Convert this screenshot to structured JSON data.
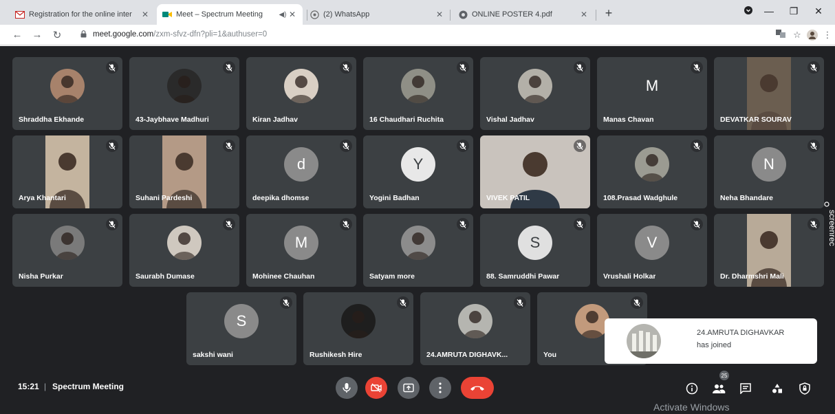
{
  "browser": {
    "tabs": [
      {
        "title": "Registration for the online inter",
        "active": false,
        "favicon": "gmail-icon"
      },
      {
        "title": "Meet – Spectrum Meeting",
        "active": true,
        "favicon": "meet-icon"
      },
      {
        "title": "(2) WhatsApp",
        "active": false,
        "favicon": "whatsapp-icon"
      },
      {
        "title": "ONLINE POSTER 4.pdf",
        "active": false,
        "favicon": "pdf-icon"
      }
    ],
    "url_host": "meet.google.com",
    "url_path": "/zxm-sfvz-dfn?pli=1&authuser=0"
  },
  "participants": [
    {
      "name": "Shraddha Ekhande",
      "type": "photo",
      "tone": "#a7826b"
    },
    {
      "name": "43-Jaybhave Madhuri",
      "type": "photo",
      "tone": "#2a2a2a"
    },
    {
      "name": "Kiran Jadhav",
      "type": "photo",
      "tone": "#d9cfc4"
    },
    {
      "name": "16 Chaudhari Ruchita",
      "type": "photo",
      "tone": "#8f8f86"
    },
    {
      "name": "Vishal Jadhav",
      "type": "photo",
      "tone": "#b3b0a8"
    },
    {
      "name": "Manas Chavan",
      "type": "letter",
      "letter": "M",
      "color": "#3c4043"
    },
    {
      "name": "DEVATKAR SOURAV",
      "type": "video",
      "tone": "#6b5e50"
    },
    {
      "name": "Arya Khantari",
      "type": "video",
      "tone": "#c4b49f"
    },
    {
      "name": "Suhani Pardeshi",
      "type": "video",
      "tone": "#b49a86"
    },
    {
      "name": "deepika dhomse",
      "type": "letter",
      "letter": "d",
      "color": "#8a8a8a"
    },
    {
      "name": "Yogini Badhan",
      "type": "letter",
      "letter": "Y",
      "color": "#e8e8e8"
    },
    {
      "name": "VIVEK PATIL",
      "type": "fullvideo",
      "tone": "#c9c3bd"
    },
    {
      "name": "108.Prasad Wadghule",
      "type": "photo",
      "tone": "#9b9b92"
    },
    {
      "name": "Neha Bhandare",
      "type": "letter",
      "letter": "N",
      "color": "#8a8a8a"
    },
    {
      "name": "Nisha Purkar",
      "type": "photo",
      "tone": "#7a7a7a"
    },
    {
      "name": "Saurabh Dumase",
      "type": "photo",
      "tone": "#cfc8bf"
    },
    {
      "name": "Mohinee Chauhan",
      "type": "letter",
      "letter": "M",
      "color": "#8a8a8a"
    },
    {
      "name": "Satyam more",
      "type": "photo",
      "tone": "#8c8c8c"
    },
    {
      "name": "88. Samruddhi Pawar",
      "type": "letter",
      "letter": "S",
      "color": "#e0e0e0"
    },
    {
      "name": "Vrushali Holkar",
      "type": "letter",
      "letter": "V",
      "color": "#8a8a8a"
    },
    {
      "name": "Dr. Dharmshri Mali",
      "type": "video",
      "tone": "#b8aa98"
    },
    {
      "name": "sakshi wani",
      "type": "letter",
      "letter": "S",
      "color": "#8a8a8a"
    },
    {
      "name": "Rushikesh Hire",
      "type": "photo",
      "tone": "#1e1e1e"
    },
    {
      "name": "24.AMRUTA DIGHAVK...",
      "type": "photo",
      "tone": "#b5b5b0"
    },
    {
      "name": "You",
      "type": "photo",
      "tone": "#c29a7c"
    }
  ],
  "toast": {
    "name": "24.AMRUTA DIGHAVKAR",
    "message": "has joined"
  },
  "footer": {
    "time": "15:21",
    "meeting_title": "Spectrum Meeting",
    "people_count": "25"
  },
  "watermark": "Activate Windows",
  "screenrec_label": "screenrec",
  "colors": {
    "stage": "#202124",
    "tile": "#3c4043",
    "end_call": "#ea4335"
  }
}
